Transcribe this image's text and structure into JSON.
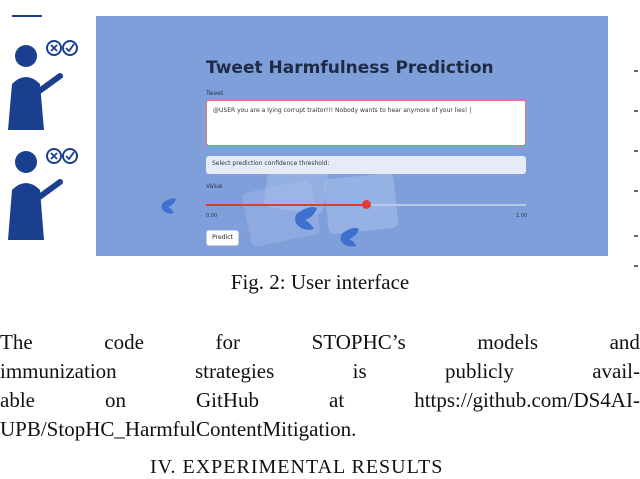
{
  "app": {
    "title": "Tweet Harmfulness Prediction",
    "tweet_label": "Tweet",
    "tweet_value": "@USER you are a lying corrupt traitor!!! Nobody wants to hear anymore of your lies! |",
    "select_placeholder": "Select prediction confidence threshold:",
    "slider_label": "Value",
    "slider_min": "0.00",
    "slider_max": "1.00",
    "slider_value": 0.5,
    "predict_label": "Predict"
  },
  "icons": [
    "person-icon",
    "close-icon",
    "check-icon",
    "twitter-bird-icon"
  ],
  "colors": {
    "app_bg": "#7f9fdb",
    "accent": "#e53935",
    "figure_blue": "#1b3f8f"
  },
  "caption": "Fig. 2: User interface",
  "paragraph": {
    "line1": [
      "The",
      "code",
      "for",
      "STOPHC’s",
      "models",
      "and"
    ],
    "line2": [
      "immunization",
      "strategies",
      "is",
      "publicly",
      "avail-"
    ],
    "line3": [
      "able",
      "on",
      "GitHub",
      "at",
      "https://github.com/DS4AI-"
    ],
    "line4": "UPB/StopHC_HarmfulContentMitigation."
  },
  "section_heading": "IV. EXPERIMENTAL RESULTS"
}
